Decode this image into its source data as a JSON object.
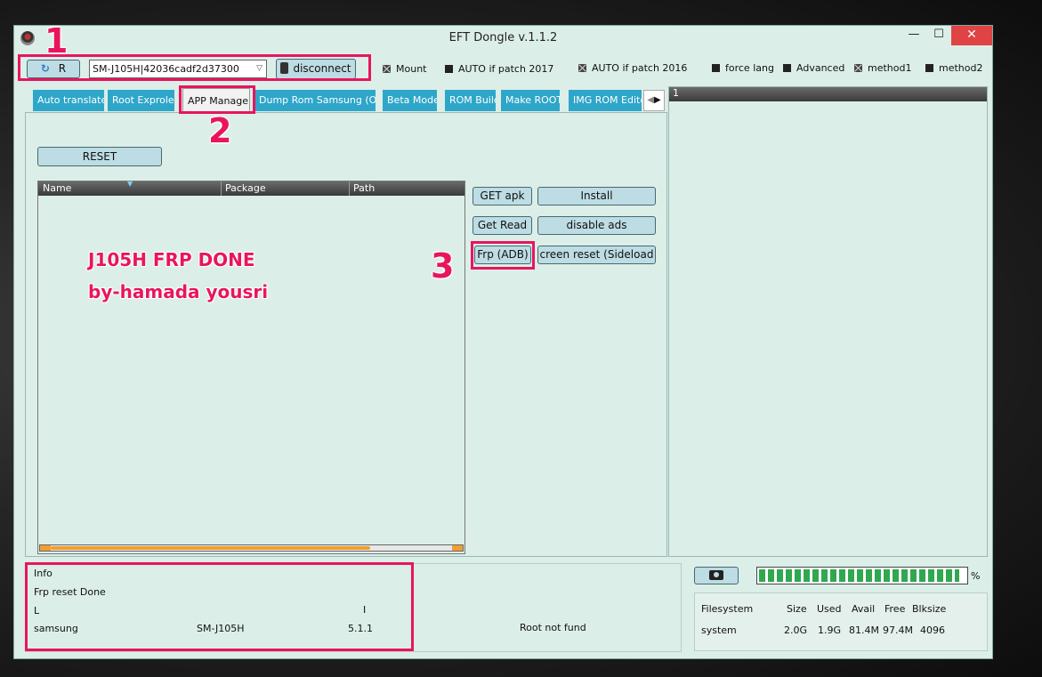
{
  "window": {
    "title": "EFT Dongle  v.1.1.2",
    "minimize": "—",
    "maximize": "☐",
    "close": "✕"
  },
  "toolbar": {
    "refresh_label": "R",
    "device_select": "SM-J105H|42036cadf2d37300",
    "disconnect_label": "disconnect",
    "checkboxes": [
      {
        "label": "Mount",
        "checked": true
      },
      {
        "label": "AUTO if patch 2017",
        "checked": false
      },
      {
        "label": "AUTO if patch 2016",
        "checked": true
      },
      {
        "label": "force lang",
        "checked": false
      },
      {
        "label": "Advanced",
        "checked": false
      },
      {
        "label": "method1",
        "checked": true
      },
      {
        "label": "method2",
        "checked": false
      }
    ]
  },
  "tabs": [
    {
      "label": "Auto translate"
    },
    {
      "label": "Root Exproler"
    },
    {
      "label": "APP Manager",
      "active": true
    },
    {
      "label": "Dump Rom Samsung (Odin)"
    },
    {
      "label": "Beta Model"
    },
    {
      "label": "ROM Build"
    },
    {
      "label": "Make ROOT"
    },
    {
      "label": "IMG ROM Editor"
    }
  ],
  "app_manager": {
    "reset_label": "RESET",
    "columns": [
      "Name",
      "Package",
      "Path"
    ],
    "buttons": {
      "get_apk": "GET apk",
      "install": "Install",
      "get_read": "Get Read",
      "disable_ads": "disable ads",
      "frp_adb": "Frp (ADB)",
      "screen_reset": "creen reset  (Sideload"
    }
  },
  "log_panel": {
    "header": "1"
  },
  "overlay": {
    "line1": "J105H FRP DONE",
    "line2": "by-hamada yousri"
  },
  "annotations": {
    "n1": "1",
    "n2": "2",
    "n3": "3"
  },
  "info": {
    "title": "Info",
    "line1": "Frp reset Done",
    "line2a": "L",
    "line2b": "I",
    "brand": "samsung",
    "model": "SM-J105H",
    "version": "5.1.1",
    "root_status": "Root not fund"
  },
  "progress": {
    "percent_sign": "%",
    "value": 0.97
  },
  "filesystem": {
    "headers": [
      "Filesystem",
      "Size",
      "Used",
      "Avail",
      "Free",
      "Blksize"
    ],
    "rows": [
      [
        "system",
        "2.0G",
        "1.9G",
        "81.4M",
        "97.4M",
        "4096"
      ]
    ]
  },
  "colors": {
    "accent": "#2ea6c9",
    "annotation": "#e8155e",
    "window_bg": "#dceee8",
    "progress": "#2fa84f"
  }
}
